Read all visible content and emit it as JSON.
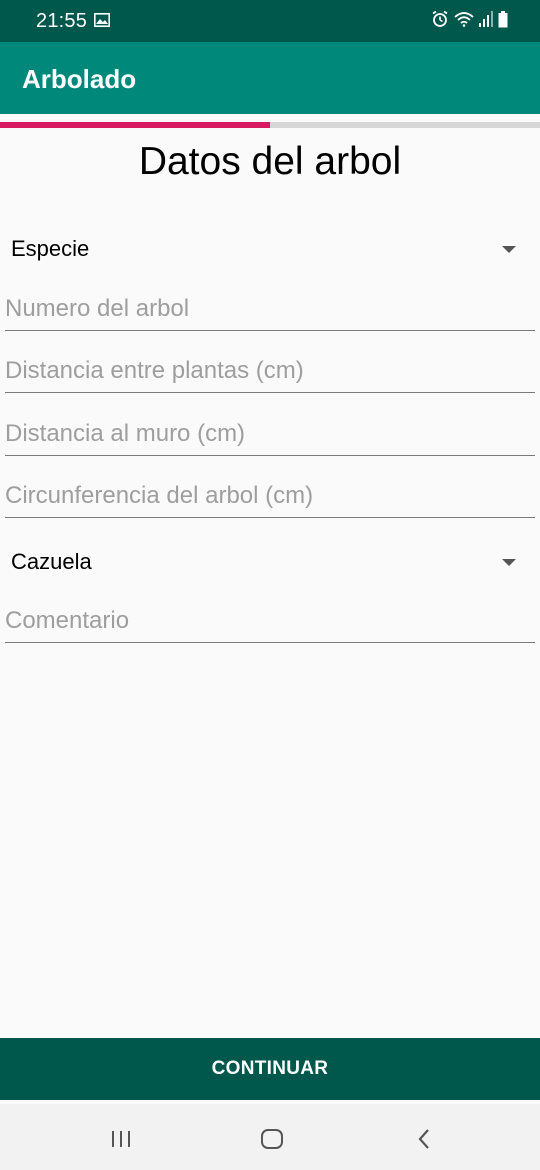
{
  "status_bar": {
    "time": "21:55",
    "icons": [
      "image-icon",
      "alarm-icon",
      "wifi-icon",
      "signal-icon",
      "battery-icon"
    ]
  },
  "app_bar": {
    "title": "Arbolado"
  },
  "progress": {
    "value": 0.5,
    "color": "#d81b60"
  },
  "form": {
    "title": "Datos del arbol",
    "species_spinner": {
      "label": "Especie"
    },
    "tree_number": {
      "placeholder": "Numero del arbol",
      "value": ""
    },
    "plant_distance": {
      "placeholder": "Distancia entre plantas (cm)",
      "value": ""
    },
    "wall_distance": {
      "placeholder": "Distancia al muro (cm)",
      "value": ""
    },
    "circumference": {
      "placeholder": "Circunferencia del arbol (cm)",
      "value": ""
    },
    "cazuela_spinner": {
      "label": "Cazuela"
    },
    "comment": {
      "placeholder": "Comentario",
      "value": ""
    }
  },
  "continue_button": {
    "label": "CONTINUAR"
  },
  "nav_bar": {
    "icons": [
      "recent-apps-icon",
      "home-icon",
      "back-icon"
    ]
  },
  "colors": {
    "primary": "#00897b",
    "primary_dark": "#00574b",
    "accent": "#d81b60"
  }
}
